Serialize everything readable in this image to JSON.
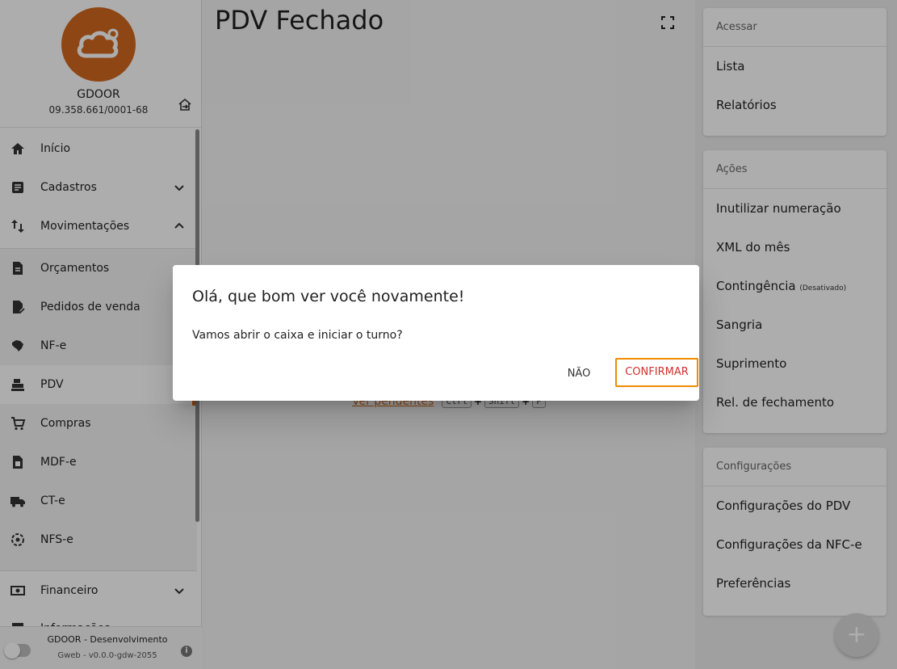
{
  "company": {
    "name": "GDOOR",
    "cnpj": "09.358.661/0001-68"
  },
  "sidebar": {
    "items": [
      {
        "label": "Início",
        "icon": "home-icon"
      },
      {
        "label": "Cadastros",
        "icon": "document-icon",
        "expanded": false
      },
      {
        "label": "Movimentações",
        "icon": "swap-vertical-icon",
        "expanded": true
      }
    ],
    "submenu": [
      {
        "label": "Orçamentos",
        "icon": "file-icon"
      },
      {
        "label": "Pedidos de venda",
        "icon": "file-check-icon"
      },
      {
        "label": "NF-e",
        "icon": "brazil-map-icon"
      },
      {
        "label": "PDV",
        "icon": "cash-register-icon",
        "active": true
      },
      {
        "label": "Compras",
        "icon": "cart-icon"
      },
      {
        "label": "MDF-e",
        "icon": "file-table-icon"
      },
      {
        "label": "CT-e",
        "icon": "truck-icon"
      },
      {
        "label": "NFS-e",
        "icon": "service-icon"
      }
    ],
    "bottom_items": [
      {
        "label": "Financeiro",
        "icon": "cash-icon"
      },
      {
        "label": "Informações",
        "icon": "chart-icon"
      }
    ],
    "footer": {
      "env": "GDOOR - Desenvolvimento",
      "version": "Gweb - v0.0.0-gdw-2055"
    }
  },
  "main": {
    "title": "PDV Fechado",
    "shortcut": {
      "link": "Ver pendentes",
      "keys": [
        "Ctrl",
        "Shift",
        "P"
      ],
      "plus": "+"
    }
  },
  "right": {
    "acessar": {
      "header": "Acessar",
      "items": [
        "Lista",
        "Relatórios"
      ]
    },
    "acoes": {
      "header": "Ações",
      "items": [
        "Inutilizar numeração",
        "XML do mês",
        "Contingência",
        "Sangria",
        "Suprimento",
        "Rel. de fechamento"
      ],
      "contingencia_note": "(Desativado)"
    },
    "configuracoes": {
      "header": "Configurações",
      "items": [
        "Configurações do PDV",
        "Configurações da NFC-e",
        "Preferências"
      ]
    },
    "fab": "+"
  },
  "dialog": {
    "title": "Olá, que bom ver você novamente!",
    "text": "Vamos abrir o caixa e iniciar o turno?",
    "no": "NÃO",
    "confirm": "CONFIRMAR"
  },
  "colors": {
    "accent": "#d2691e",
    "confirm_text": "#d32f2f",
    "focus_outline": "#f08a00"
  }
}
